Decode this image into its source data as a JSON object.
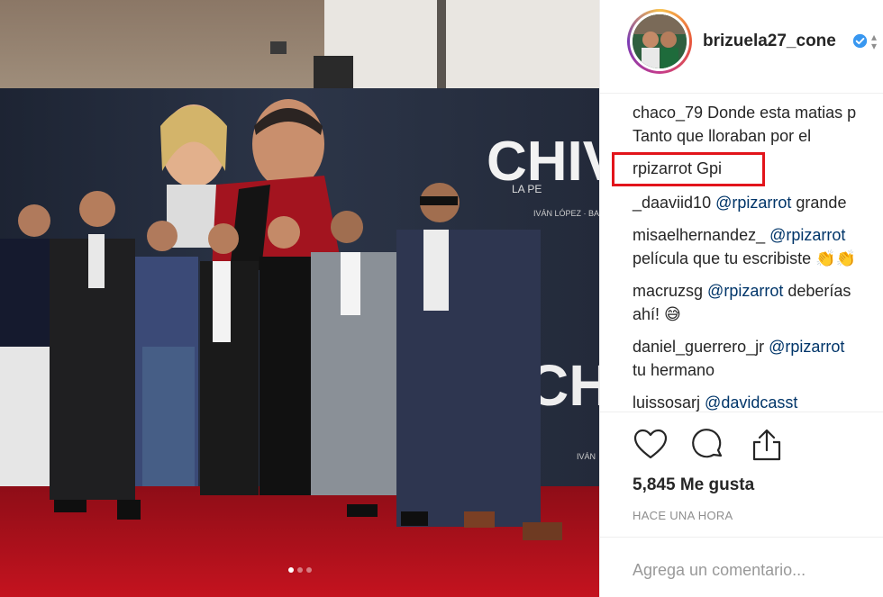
{
  "post": {
    "username": "brizuela27_cone",
    "verified_icon": "verified-badge-icon",
    "carousel_dots": [
      true,
      false,
      false
    ],
    "poster_text": {
      "title_top": "CHIV",
      "subtitle": "LA PE",
      "credits": "IVÁN LÓPEZ · BARBA",
      "title_bottom": "CHIV",
      "credits_bottom": "IVÁN"
    }
  },
  "comments": [
    {
      "author": "chaco_79",
      "text": "Donde esta matias p",
      "text2": "Tanto que lloraban por el"
    },
    {
      "author": "rpizarrot",
      "text": "Gpi"
    },
    {
      "author": "_daaviid10",
      "mention": "@rpizarrot",
      "text": "grande"
    },
    {
      "author": "misaelhernandez_",
      "mention": "@rpizarrot",
      "text": "",
      "text2": "película que tu escribiste 👏👏"
    },
    {
      "author": "macruzsg",
      "mention": "@rpizarrot",
      "text": "deberías",
      "text2": "ahí! 😅"
    },
    {
      "author": "daniel_guerrero_jr",
      "mention": "@rpizarrot",
      "text": "",
      "text2": "tu hermano"
    },
    {
      "author": "luissosarj",
      "mention": "@davidcasst",
      "text": ""
    }
  ],
  "actions": {
    "like_icon": "heart-icon",
    "comment_icon": "comment-bubble-icon",
    "share_icon": "share-icon"
  },
  "likes_text": "5,845 Me gusta",
  "time_text": "HACE UNA HORA",
  "add_comment_placeholder": "Agrega un comentario...",
  "colors": {
    "highlight": "#e2141b",
    "mention": "#003569",
    "carpet": "#b3121e",
    "verified": "#3897f0"
  }
}
